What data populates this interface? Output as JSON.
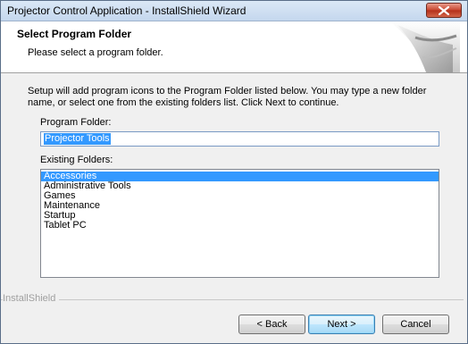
{
  "window": {
    "title": "Projector Control Application - InstallShield Wizard"
  },
  "header": {
    "title": "Select Program Folder",
    "subtitle": "Please select a program folder."
  },
  "body": {
    "instructions": "Setup will add program icons to the Program Folder listed below.  You may type a new folder name, or select one from the existing folders list.  Click Next to continue.",
    "program_folder_label": "Program Folder:",
    "program_folder_value": "Projector Tools",
    "existing_folders_label": "Existing Folders:",
    "folders": [
      {
        "label": "Accessories",
        "selected": true
      },
      {
        "label": "Administrative Tools",
        "selected": false
      },
      {
        "label": "Games",
        "selected": false
      },
      {
        "label": "Maintenance",
        "selected": false
      },
      {
        "label": "Startup",
        "selected": false
      },
      {
        "label": "Tablet PC",
        "selected": false
      }
    ]
  },
  "footer": {
    "brand": "InstallShield",
    "back_label": "< Back",
    "next_label": "Next >",
    "cancel_label": "Cancel"
  },
  "colors": {
    "selection": "#3399ff",
    "close_button": "#c8452e"
  }
}
